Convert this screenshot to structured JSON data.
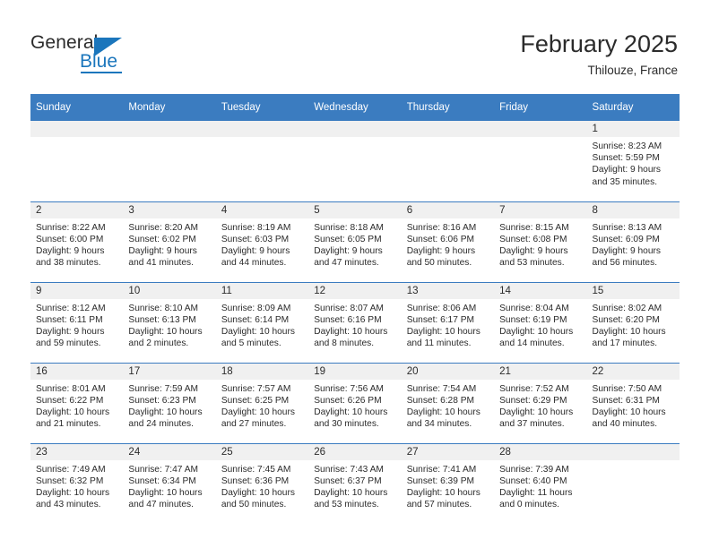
{
  "brand": {
    "name_top": "General",
    "name_bottom": "Blue",
    "accent_color": "#1b76bc"
  },
  "header": {
    "title": "February 2025",
    "location": "Thilouze, France",
    "header_bg": "#3b7cc0",
    "daynum_bg": "#f0f0f0"
  },
  "weekday_headers": [
    "Sunday",
    "Monday",
    "Tuesday",
    "Wednesday",
    "Thursday",
    "Friday",
    "Saturday"
  ],
  "weeks": [
    [
      {
        "day": "",
        "lines": []
      },
      {
        "day": "",
        "lines": []
      },
      {
        "day": "",
        "lines": []
      },
      {
        "day": "",
        "lines": []
      },
      {
        "day": "",
        "lines": []
      },
      {
        "day": "",
        "lines": []
      },
      {
        "day": "1",
        "lines": [
          "Sunrise: 8:23 AM",
          "Sunset: 5:59 PM",
          "Daylight: 9 hours",
          "and 35 minutes."
        ]
      }
    ],
    [
      {
        "day": "2",
        "lines": [
          "Sunrise: 8:22 AM",
          "Sunset: 6:00 PM",
          "Daylight: 9 hours",
          "and 38 minutes."
        ]
      },
      {
        "day": "3",
        "lines": [
          "Sunrise: 8:20 AM",
          "Sunset: 6:02 PM",
          "Daylight: 9 hours",
          "and 41 minutes."
        ]
      },
      {
        "day": "4",
        "lines": [
          "Sunrise: 8:19 AM",
          "Sunset: 6:03 PM",
          "Daylight: 9 hours",
          "and 44 minutes."
        ]
      },
      {
        "day": "5",
        "lines": [
          "Sunrise: 8:18 AM",
          "Sunset: 6:05 PM",
          "Daylight: 9 hours",
          "and 47 minutes."
        ]
      },
      {
        "day": "6",
        "lines": [
          "Sunrise: 8:16 AM",
          "Sunset: 6:06 PM",
          "Daylight: 9 hours",
          "and 50 minutes."
        ]
      },
      {
        "day": "7",
        "lines": [
          "Sunrise: 8:15 AM",
          "Sunset: 6:08 PM",
          "Daylight: 9 hours",
          "and 53 minutes."
        ]
      },
      {
        "day": "8",
        "lines": [
          "Sunrise: 8:13 AM",
          "Sunset: 6:09 PM",
          "Daylight: 9 hours",
          "and 56 minutes."
        ]
      }
    ],
    [
      {
        "day": "9",
        "lines": [
          "Sunrise: 8:12 AM",
          "Sunset: 6:11 PM",
          "Daylight: 9 hours",
          "and 59 minutes."
        ]
      },
      {
        "day": "10",
        "lines": [
          "Sunrise: 8:10 AM",
          "Sunset: 6:13 PM",
          "Daylight: 10 hours",
          "and 2 minutes."
        ]
      },
      {
        "day": "11",
        "lines": [
          "Sunrise: 8:09 AM",
          "Sunset: 6:14 PM",
          "Daylight: 10 hours",
          "and 5 minutes."
        ]
      },
      {
        "day": "12",
        "lines": [
          "Sunrise: 8:07 AM",
          "Sunset: 6:16 PM",
          "Daylight: 10 hours",
          "and 8 minutes."
        ]
      },
      {
        "day": "13",
        "lines": [
          "Sunrise: 8:06 AM",
          "Sunset: 6:17 PM",
          "Daylight: 10 hours",
          "and 11 minutes."
        ]
      },
      {
        "day": "14",
        "lines": [
          "Sunrise: 8:04 AM",
          "Sunset: 6:19 PM",
          "Daylight: 10 hours",
          "and 14 minutes."
        ]
      },
      {
        "day": "15",
        "lines": [
          "Sunrise: 8:02 AM",
          "Sunset: 6:20 PM",
          "Daylight: 10 hours",
          "and 17 minutes."
        ]
      }
    ],
    [
      {
        "day": "16",
        "lines": [
          "Sunrise: 8:01 AM",
          "Sunset: 6:22 PM",
          "Daylight: 10 hours",
          "and 21 minutes."
        ]
      },
      {
        "day": "17",
        "lines": [
          "Sunrise: 7:59 AM",
          "Sunset: 6:23 PM",
          "Daylight: 10 hours",
          "and 24 minutes."
        ]
      },
      {
        "day": "18",
        "lines": [
          "Sunrise: 7:57 AM",
          "Sunset: 6:25 PM",
          "Daylight: 10 hours",
          "and 27 minutes."
        ]
      },
      {
        "day": "19",
        "lines": [
          "Sunrise: 7:56 AM",
          "Sunset: 6:26 PM",
          "Daylight: 10 hours",
          "and 30 minutes."
        ]
      },
      {
        "day": "20",
        "lines": [
          "Sunrise: 7:54 AM",
          "Sunset: 6:28 PM",
          "Daylight: 10 hours",
          "and 34 minutes."
        ]
      },
      {
        "day": "21",
        "lines": [
          "Sunrise: 7:52 AM",
          "Sunset: 6:29 PM",
          "Daylight: 10 hours",
          "and 37 minutes."
        ]
      },
      {
        "day": "22",
        "lines": [
          "Sunrise: 7:50 AM",
          "Sunset: 6:31 PM",
          "Daylight: 10 hours",
          "and 40 minutes."
        ]
      }
    ],
    [
      {
        "day": "23",
        "lines": [
          "Sunrise: 7:49 AM",
          "Sunset: 6:32 PM",
          "Daylight: 10 hours",
          "and 43 minutes."
        ]
      },
      {
        "day": "24",
        "lines": [
          "Sunrise: 7:47 AM",
          "Sunset: 6:34 PM",
          "Daylight: 10 hours",
          "and 47 minutes."
        ]
      },
      {
        "day": "25",
        "lines": [
          "Sunrise: 7:45 AM",
          "Sunset: 6:36 PM",
          "Daylight: 10 hours",
          "and 50 minutes."
        ]
      },
      {
        "day": "26",
        "lines": [
          "Sunrise: 7:43 AM",
          "Sunset: 6:37 PM",
          "Daylight: 10 hours",
          "and 53 minutes."
        ]
      },
      {
        "day": "27",
        "lines": [
          "Sunrise: 7:41 AM",
          "Sunset: 6:39 PM",
          "Daylight: 10 hours",
          "and 57 minutes."
        ]
      },
      {
        "day": "28",
        "lines": [
          "Sunrise: 7:39 AM",
          "Sunset: 6:40 PM",
          "Daylight: 11 hours",
          "and 0 minutes."
        ]
      },
      {
        "day": "",
        "lines": []
      }
    ]
  ]
}
